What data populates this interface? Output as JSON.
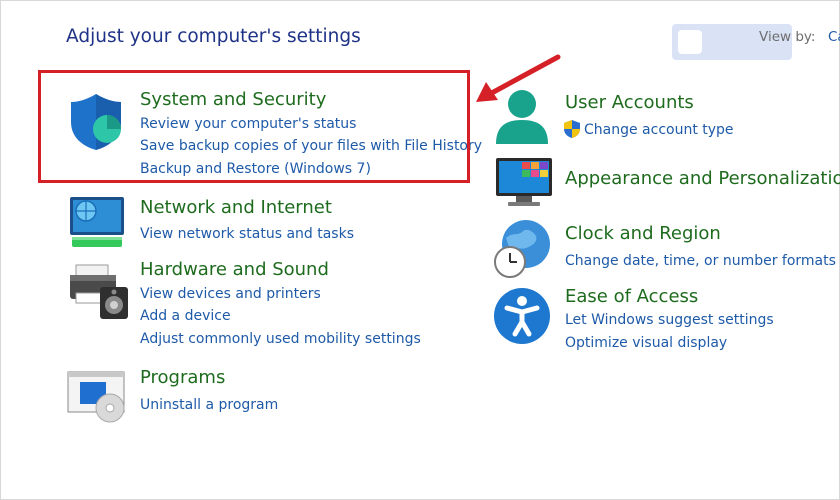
{
  "header": {
    "title": "Adjust your computer's settings"
  },
  "view_by": {
    "label": "View by:",
    "value": "Category"
  },
  "categories_left": [
    {
      "title": "System and Security",
      "icon": "shield-icon",
      "links": [
        "Review your computer's status",
        "Save backup copies of your files with File History",
        "Backup and Restore (Windows 7)"
      ]
    },
    {
      "title": "Network and Internet",
      "icon": "network-globe-icon",
      "links": [
        "View network status and tasks"
      ]
    },
    {
      "title": "Hardware and Sound",
      "icon": "printer-speaker-icon",
      "links": [
        "View devices and printers",
        "Add a device",
        "Adjust commonly used mobility settings"
      ]
    },
    {
      "title": "Programs",
      "icon": "programs-disc-icon",
      "links": [
        "Uninstall a program"
      ]
    }
  ],
  "categories_right": [
    {
      "title": "User Accounts",
      "icon": "user-icon",
      "links": [
        "Change account type"
      ]
    },
    {
      "title": "Appearance and Personalization",
      "icon": "monitor-tiles-icon",
      "links": []
    },
    {
      "title": "Clock and Region",
      "icon": "clock-globe-icon",
      "links": [
        "Change date, time, or number formats"
      ]
    },
    {
      "title": "Ease of Access",
      "icon": "accessibility-icon",
      "links": [
        "Let Windows suggest settings",
        "Optimize visual display"
      ]
    }
  ],
  "annotations": {
    "highlight_color": "#d42026",
    "arrow_color": "#d42026"
  },
  "colors": {
    "category_title": "#1e6b1e",
    "link": "#1e5aa8",
    "header": "#1e3287"
  }
}
